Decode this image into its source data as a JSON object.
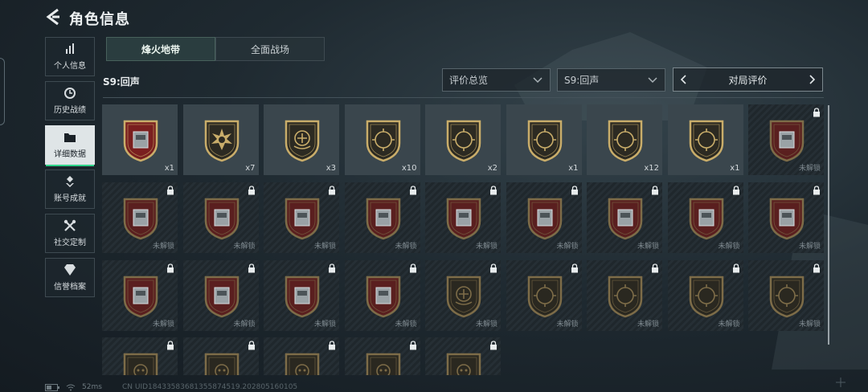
{
  "header": {
    "title": "角色信息"
  },
  "sidebar": {
    "items": [
      {
        "label": "个人信息",
        "icon": "bar-chart-icon",
        "active": false
      },
      {
        "label": "历史战绩",
        "icon": "clock-icon",
        "active": false
      },
      {
        "label": "详细数据",
        "icon": "folder-icon",
        "active": true
      },
      {
        "label": "账号成就",
        "icon": "medal-icon",
        "active": false
      },
      {
        "label": "社交定制",
        "icon": "tools-icon",
        "active": false
      },
      {
        "label": "信誉档案",
        "icon": "diamond-icon",
        "active": false
      }
    ]
  },
  "tabs": [
    {
      "label": "烽火地带",
      "active": true
    },
    {
      "label": "全面战场",
      "active": false
    }
  ],
  "season_label": "S9:回声",
  "filters": {
    "overview": "评价总览",
    "season": "S9:回声",
    "match_rating": "对局评价"
  },
  "badges": [
    {
      "unlocked": true,
      "count": "x1",
      "icon": "vending-machine-icon",
      "inner": "#7a1f1f"
    },
    {
      "unlocked": true,
      "count": "x7",
      "icon": "starburst-icon",
      "inner": "#2c2a22"
    },
    {
      "unlocked": true,
      "count": "x3",
      "icon": "emblem-icon",
      "inner": "#2c2a22"
    },
    {
      "unlocked": true,
      "count": "x10",
      "icon": "rifle-crosshair-icon",
      "inner": "#2c2a22"
    },
    {
      "unlocked": true,
      "count": "x2",
      "icon": "smg-crosshair-icon",
      "inner": "#2c2a22"
    },
    {
      "unlocked": true,
      "count": "x1",
      "icon": "knife-crosshair-icon",
      "inner": "#2c2a22"
    },
    {
      "unlocked": true,
      "count": "x12",
      "icon": "blade-crosshair-icon",
      "inner": "#2c2a22"
    },
    {
      "unlocked": true,
      "count": "x1",
      "icon": "soldier-crosshair-icon",
      "inner": "#2c2a22"
    },
    {
      "unlocked": false,
      "count": "未解锁",
      "icon": "helmet-icon",
      "inner": "#5a1f1f"
    },
    {
      "unlocked": false,
      "count": "未解锁",
      "icon": "globe-icon",
      "inner": "#5a1f1f"
    },
    {
      "unlocked": false,
      "count": "未解锁",
      "icon": "tank-icon",
      "inner": "#5a1f1f"
    },
    {
      "unlocked": false,
      "count": "未解锁",
      "icon": "server-icon",
      "inner": "#5a1f1f"
    },
    {
      "unlocked": false,
      "count": "未解锁",
      "icon": "terminal-icon",
      "inner": "#5a1f1f"
    },
    {
      "unlocked": false,
      "count": "未解锁",
      "icon": "panel-icon",
      "inner": "#5a1f1f"
    },
    {
      "unlocked": false,
      "count": "未解锁",
      "icon": "crates-icon",
      "inner": "#5a1f1f"
    },
    {
      "unlocked": false,
      "count": "未解锁",
      "icon": "circuit-board-icon",
      "inner": "#5a1f1f"
    },
    {
      "unlocked": false,
      "count": "未解锁",
      "icon": "lantern-icon",
      "inner": "#5a1f1f"
    },
    {
      "unlocked": false,
      "count": "未解锁",
      "icon": "drum-icon",
      "inner": "#5a1f1f"
    },
    {
      "unlocked": false,
      "count": "未解锁",
      "icon": "chessboard-icon",
      "inner": "#5a1f1f"
    },
    {
      "unlocked": false,
      "count": "未解锁",
      "icon": "vehicle-icon",
      "inner": "#5a1f1f"
    },
    {
      "unlocked": false,
      "count": "未解锁",
      "icon": "frame-icon",
      "inner": "#5a1f1f"
    },
    {
      "unlocked": false,
      "count": "未解锁",
      "icon": "cabinet-icon",
      "inner": "#5a1f1f"
    },
    {
      "unlocked": false,
      "count": "未解锁",
      "icon": "emblem-icon",
      "inner": "#2a2820"
    },
    {
      "unlocked": false,
      "count": "未解锁",
      "icon": "rifle-crosshair-icon",
      "inner": "#2a2820"
    },
    {
      "unlocked": false,
      "count": "未解锁",
      "icon": "smg-crosshair-icon",
      "inner": "#2a2820"
    },
    {
      "unlocked": false,
      "count": "未解锁",
      "icon": "knife-crosshair-icon",
      "inner": "#2a2820"
    },
    {
      "unlocked": false,
      "count": "未解锁",
      "icon": "pistol-crosshair-icon",
      "inner": "#2a2820"
    },
    {
      "unlocked": false,
      "count": "",
      "icon": "soldier-icon",
      "inner": "#2a2820"
    },
    {
      "unlocked": false,
      "count": "",
      "icon": "skull-icon",
      "inner": "#2a2820"
    },
    {
      "unlocked": false,
      "count": "",
      "icon": "skull-icon",
      "inner": "#2a2820"
    },
    {
      "unlocked": false,
      "count": "",
      "icon": "mask-icon",
      "inner": "#2a2820"
    },
    {
      "unlocked": false,
      "count": "",
      "icon": "skull-icon",
      "inner": "#2a2820"
    }
  ],
  "status": {
    "ping": "52ms"
  },
  "uid_text": "CN UID18433583681355874519.202805160105",
  "colors": {
    "accent": "#2fd38a",
    "gold": "#b59a5c"
  }
}
